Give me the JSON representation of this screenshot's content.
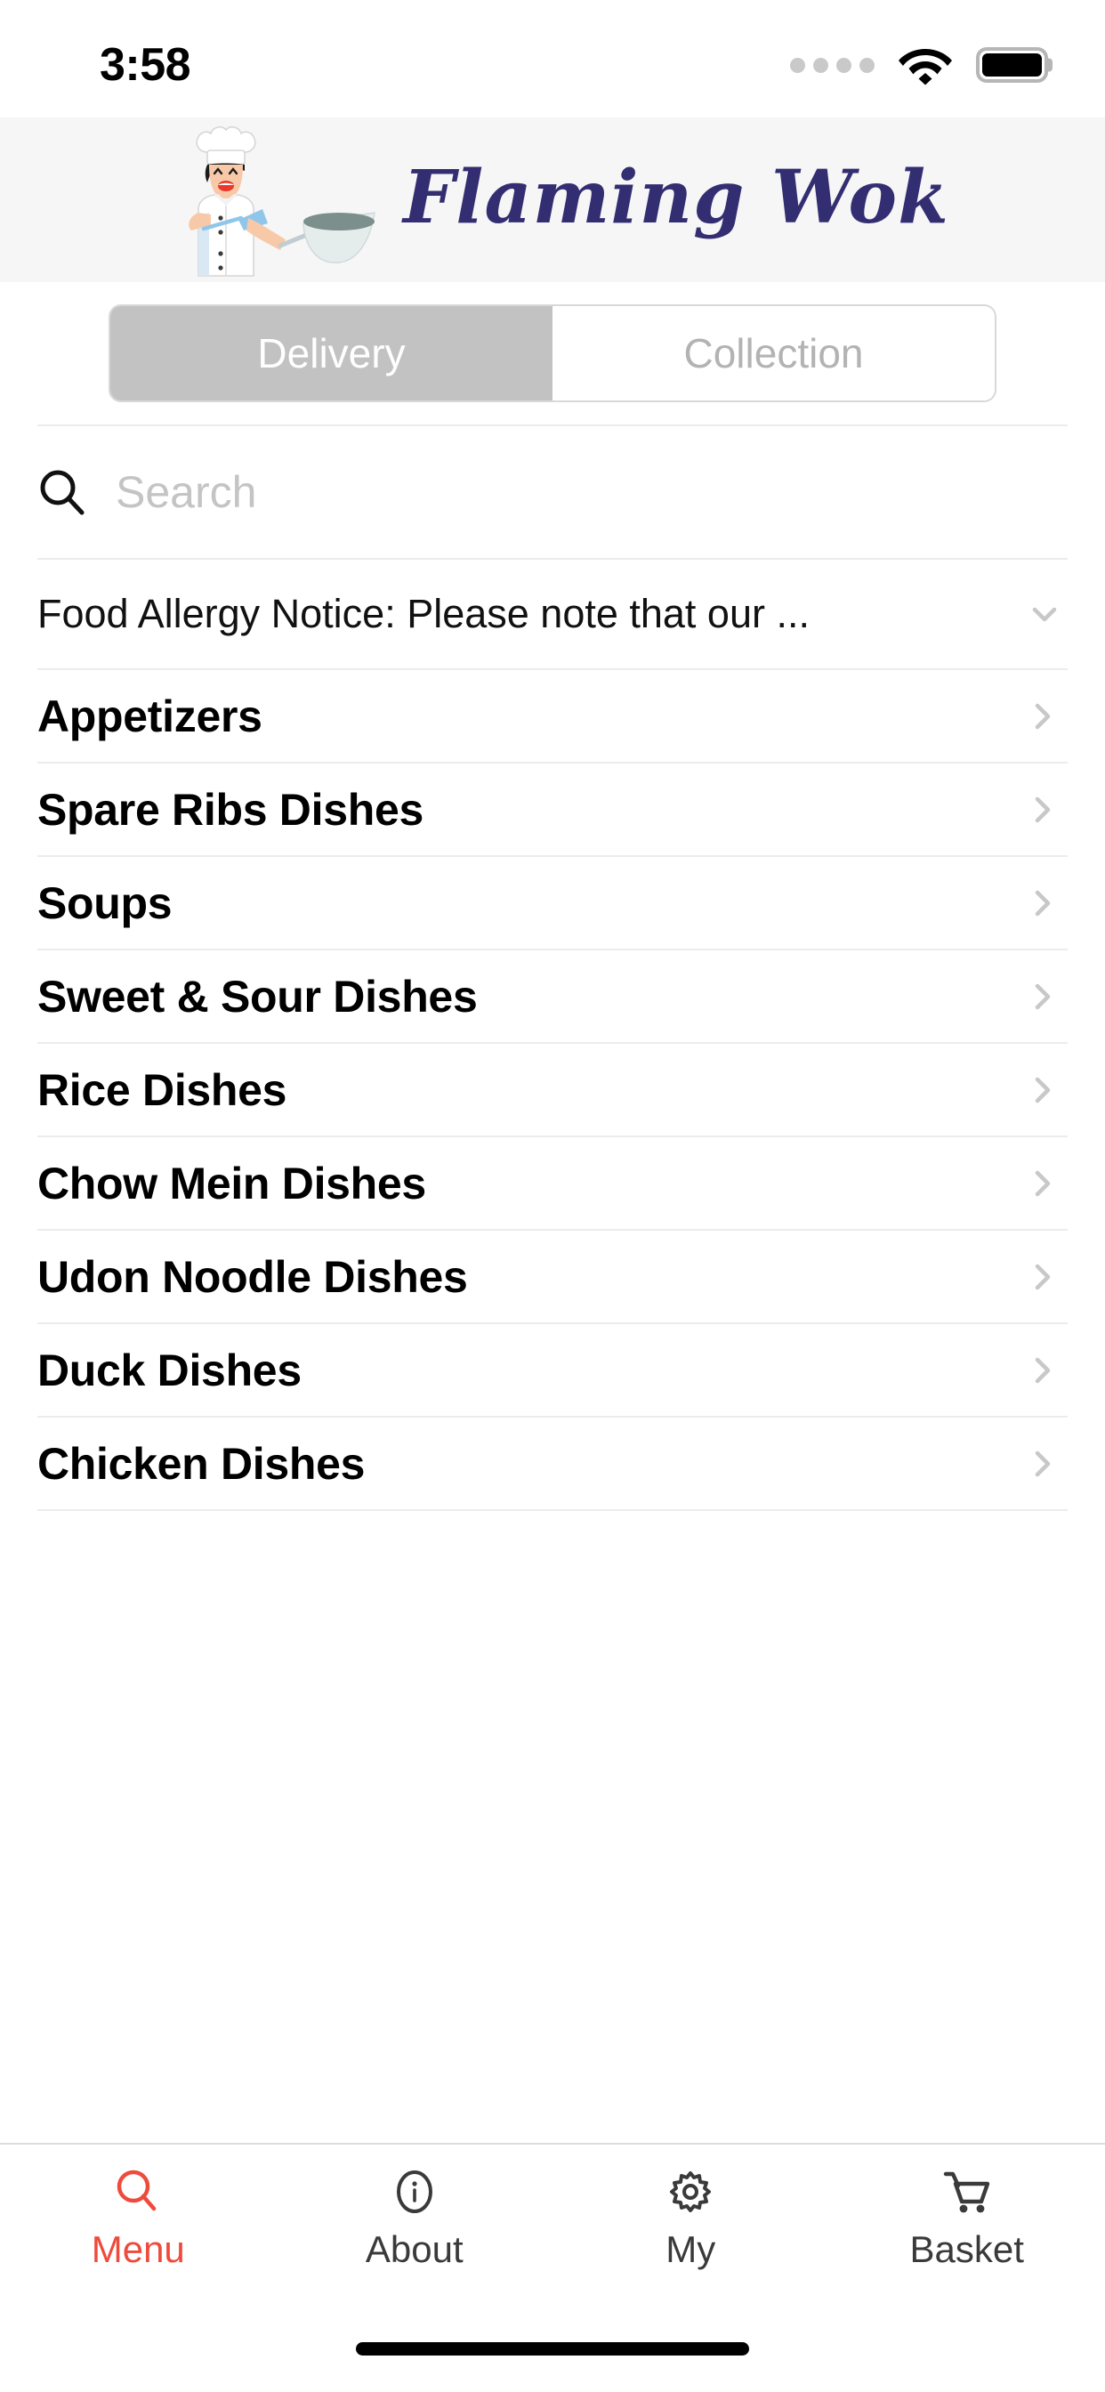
{
  "statusbar": {
    "time": "3:58",
    "signal_icon": "signal-dots-icon",
    "wifi_icon": "wifi-icon",
    "battery_icon": "battery-full-icon"
  },
  "header": {
    "brand_name": "Flaming Wok",
    "logo_icon": "chef-with-wok-icon",
    "brand_color": "#332e72",
    "background_color": "#f6f6f6"
  },
  "order_mode_toggle": {
    "options": [
      {
        "label": "Delivery",
        "selected": true
      },
      {
        "label": "Collection",
        "selected": false
      }
    ],
    "selected_bg": "#c2c2c2",
    "selected_text_color": "#ffffff",
    "unselected_text_color": "#b3b3b3"
  },
  "search": {
    "placeholder": "Search",
    "value": "",
    "icon": "search-icon"
  },
  "allergy_notice": {
    "text": "Food Allergy Notice: Please note that our ...",
    "chevron_icon": "chevron-down-icon"
  },
  "categories": [
    {
      "label": "Appetizers",
      "chevron_icon": "chevron-right-icon"
    },
    {
      "label": "Spare Ribs Dishes",
      "chevron_icon": "chevron-right-icon"
    },
    {
      "label": "Soups",
      "chevron_icon": "chevron-right-icon"
    },
    {
      "label": "Sweet & Sour Dishes",
      "chevron_icon": "chevron-right-icon"
    },
    {
      "label": "Rice Dishes",
      "chevron_icon": "chevron-right-icon"
    },
    {
      "label": "Chow Mein Dishes",
      "chevron_icon": "chevron-right-icon"
    },
    {
      "label": "Udon Noodle Dishes",
      "chevron_icon": "chevron-right-icon"
    },
    {
      "label": "Duck Dishes",
      "chevron_icon": "chevron-right-icon"
    },
    {
      "label": "Chicken Dishes",
      "chevron_icon": "chevron-right-icon"
    }
  ],
  "tabbar": {
    "active_color": "#ee4b3c",
    "inactive_color": "#3a3a3a",
    "items": [
      {
        "label": "Menu",
        "icon": "search-icon",
        "active": true
      },
      {
        "label": "About",
        "icon": "info-circle-icon",
        "active": false
      },
      {
        "label": "My",
        "icon": "gear-icon",
        "active": false
      },
      {
        "label": "Basket",
        "icon": "shopping-cart-icon",
        "active": false
      }
    ]
  },
  "home_indicator": {
    "present": true
  }
}
